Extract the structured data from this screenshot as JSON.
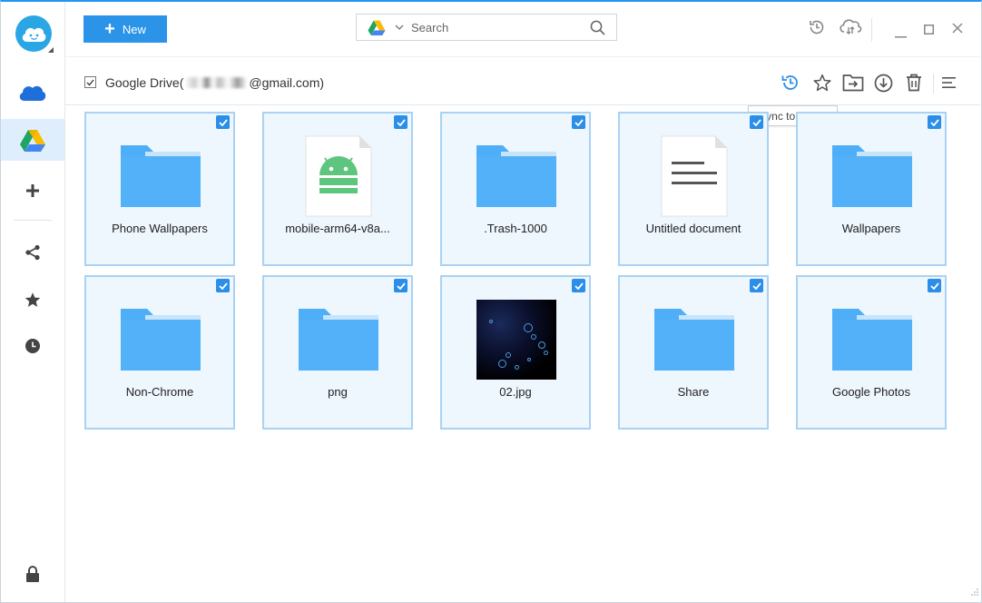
{
  "toolbar": {
    "new_label": "New",
    "search_placeholder": "Search"
  },
  "path": {
    "service": "Google Drive",
    "open_paren": "(",
    "account_suffix": "@gmail.com)"
  },
  "tooltip": {
    "text": "Sync to Cloud"
  },
  "files": [
    {
      "name": "Phone Wallpapers",
      "type": "folder",
      "checked": true
    },
    {
      "name": "mobile-arm64-v8a...",
      "type": "android-file",
      "checked": true
    },
    {
      "name": ".Trash-1000",
      "type": "folder",
      "checked": true
    },
    {
      "name": "Untitled document",
      "type": "document",
      "checked": true
    },
    {
      "name": "Wallpapers",
      "type": "folder",
      "checked": true
    },
    {
      "name": "Non-Chrome",
      "type": "folder",
      "checked": true
    },
    {
      "name": "png",
      "type": "folder",
      "checked": true
    },
    {
      "name": "02.jpg",
      "type": "image",
      "checked": true
    },
    {
      "name": "Share",
      "type": "folder",
      "checked": true
    },
    {
      "name": "Google Photos",
      "type": "folder",
      "checked": true
    }
  ],
  "colors": {
    "accent": "#2b94e8",
    "folder": "#4eaef8",
    "tile_bg": "#eef6fe",
    "tile_border": "#a9d2f4",
    "android": "#5ec57e"
  },
  "icons": {
    "sidebar": [
      "logo-cloud-face-icon",
      "onedrive-cloud-icon",
      "google-drive-icon",
      "plus-icon",
      "share-icon",
      "star-icon",
      "clock-icon",
      "lock-icon"
    ],
    "top": [
      "search-icon",
      "history-icon",
      "cloud-sync-icon",
      "minimize-icon",
      "maximize-icon",
      "close-icon"
    ],
    "path_tools": [
      "sync-to-cloud-icon",
      "star-outline-icon",
      "move-to-folder-icon",
      "download-icon",
      "trash-icon",
      "list-view-icon"
    ]
  }
}
